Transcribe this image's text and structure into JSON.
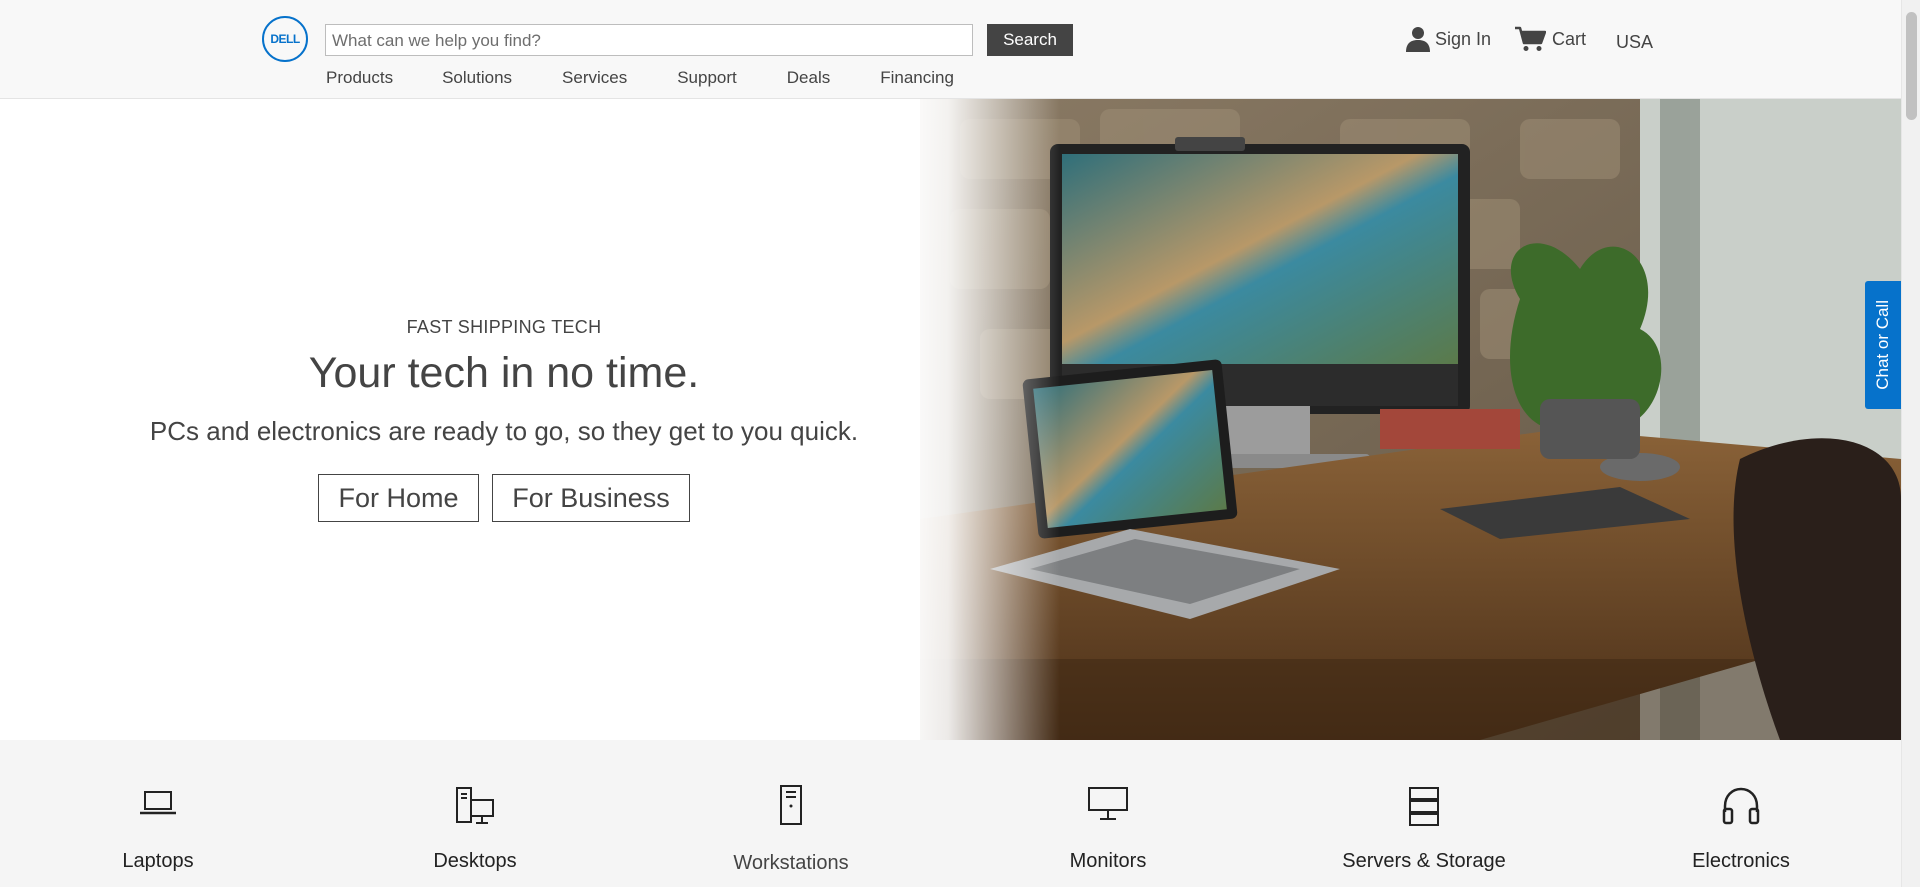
{
  "header": {
    "logo_text": "DELL",
    "search": {
      "placeholder": "What can we help you find?",
      "button_label": "Search"
    },
    "nav": [
      "Products",
      "Solutions",
      "Services",
      "Support",
      "Deals",
      "Financing"
    ],
    "utility": {
      "sign_in_label": "Sign In",
      "cart_label": "Cart",
      "region_label": "USA",
      "user_icon": "user-icon",
      "cart_icon": "cart-icon"
    }
  },
  "hero": {
    "eyebrow": "FAST SHIPPING TECH",
    "headline": "Your tech in no time.",
    "subhead": "PCs and electronics are ready to go, so they get to you quick.",
    "cta_home": "For Home",
    "cta_business": "For Business"
  },
  "chat_tab_label": "Chat or Call",
  "categories": [
    {
      "label": "Laptops",
      "icon": "laptop-icon"
    },
    {
      "label": "Desktops",
      "icon": "desktop-icon"
    },
    {
      "label": "Workstations",
      "icon": "workstation-icon"
    },
    {
      "label": "Monitors",
      "icon": "monitor-icon"
    },
    {
      "label": "Servers & Storage",
      "icon": "server-icon"
    },
    {
      "label": "Electronics",
      "icon": "headphones-icon"
    }
  ],
  "colors": {
    "brand_blue": "#0672cb",
    "search_button": "#444444",
    "header_bg": "#f8f8f8",
    "category_bg": "#f5f5f5"
  }
}
